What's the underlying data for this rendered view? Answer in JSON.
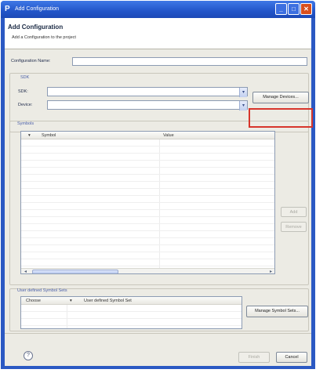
{
  "window": {
    "title": "Add Configuration",
    "app_icon": "P"
  },
  "header": {
    "title": "Add Configuration",
    "description": "Add a Configuration to the project"
  },
  "form": {
    "config_name_label": "Configuration Name:",
    "config_name_value": "",
    "sdk_group_title": "SDK",
    "sdk_label": "SDK:",
    "sdk_value": "",
    "device_label": "Device:",
    "device_value": "",
    "manage_devices_label": "Manage Devices..."
  },
  "symbols": {
    "group_title": "Symbols",
    "columns": [
      "Symbol",
      "Value"
    ],
    "rows": [],
    "add_label": "Add",
    "remove_label": "Remove"
  },
  "symbol_sets": {
    "group_title": "User defined Symbol Sets",
    "columns": [
      "Choose",
      "User defined Symbol Set"
    ],
    "rows": [],
    "manage_label": "Manage Symbol Sets..."
  },
  "footer": {
    "help_icon": "?",
    "finish_label": "Finish",
    "cancel_label": "Cancel"
  },
  "colors": {
    "titlebar": "#2255c9",
    "highlight": "#d7352b",
    "group_title": "#4a5fa8"
  }
}
